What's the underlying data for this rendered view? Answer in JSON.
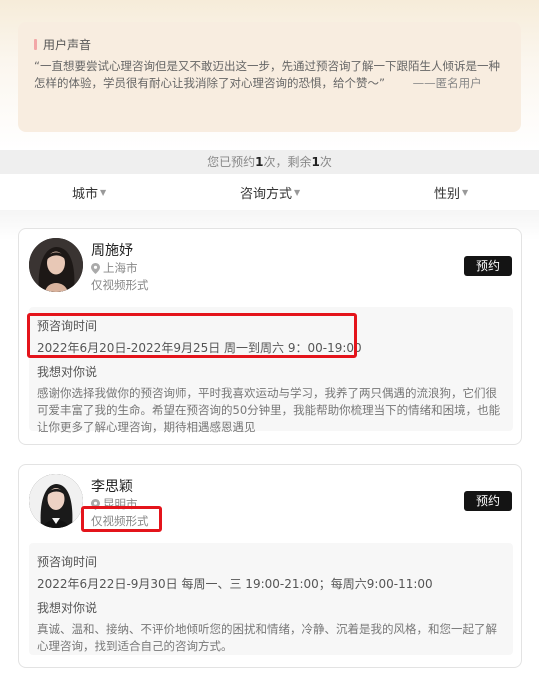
{
  "voice": {
    "title": "用户声音",
    "text": "“一直想要尝试心理咨询但是又不敢迈出这一步，先通过预咨询了解一下跟陌生人倾诉是一种怎样的体验，学员很有耐心让我消除了对心理咨询的恐惧，给个赞～”",
    "author": "——匿名用户"
  },
  "quota": {
    "prefix": "您已预约",
    "used": "1",
    "mid": "次，剩余",
    "remaining": "1",
    "suffix": "次"
  },
  "filters": {
    "city": "城市",
    "mode": "咨询方式",
    "gender": "性别",
    "caret_icon": "caret-down-icon"
  },
  "counselors": [
    {
      "name": "周施妤",
      "city": "上海市",
      "mode": "仅视频形式",
      "book_label": "预约",
      "time_title": "预咨询时间",
      "time": "2022年6月20日-2022年9月25日 周一到周六 9：00-19:00",
      "words_title": "我想对你说",
      "words": "感谢你选择我做你的预咨询师，平时我喜欢运动与学习，我养了两只偶遇的流浪狗，它们很可爱丰富了我的生命。希望在预咨询的50分钟里，我能帮助你梳理当下的情绪和困境，也能让你更多了解心理咨询，期待相遇感恩遇见"
    },
    {
      "name": "李思颖",
      "city": "昆明市",
      "mode": "仅视频形式",
      "book_label": "预约",
      "time_title": "预咨询时间",
      "time": "2022年6月22日-9月30日 每周一、三 19:00-21:00；每周六9:00-11:00",
      "words_title": "我想对你说",
      "words": "真诚、温和、接纳、不评价地倾听您的困扰和情绪，冷静、沉着是我的风格，和您一起了解心理咨询，找到适合自己的咨询方式。"
    }
  ],
  "colors": {
    "accent_pink": "#f2a7a7",
    "button_black": "#141414",
    "highlight_red": "#e4141b"
  }
}
